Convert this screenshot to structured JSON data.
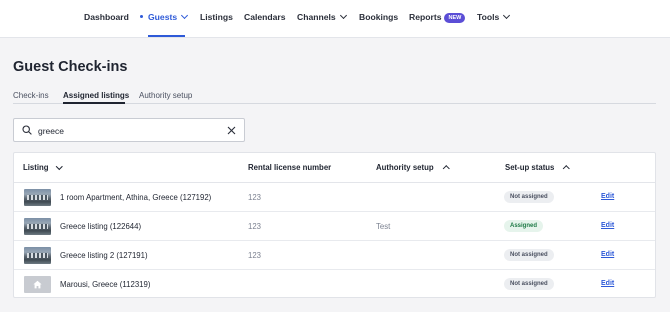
{
  "nav": {
    "items": [
      {
        "label": "Dashboard"
      },
      {
        "label": "Guests"
      },
      {
        "label": "Listings"
      },
      {
        "label": "Calendars"
      },
      {
        "label": "Channels"
      },
      {
        "label": "Bookings"
      },
      {
        "label": "Reports",
        "badge": "NEW"
      },
      {
        "label": "Tools"
      }
    ],
    "accent_color": "#2e5ad8",
    "badge_color": "#5b4ed6"
  },
  "page": {
    "title": "Guest Check-ins"
  },
  "tabs": [
    {
      "label": "Check-ins"
    },
    {
      "label": "Assigned listings"
    },
    {
      "label": "Authority setup"
    }
  ],
  "search": {
    "value": "greece"
  },
  "table": {
    "headers": {
      "listing": "Listing",
      "license": "Rental license number",
      "authority": "Authority setup",
      "status": "Set-up status"
    },
    "rows": [
      {
        "name": "1 room Apartment, Athina, Greece (127192)",
        "license": "123",
        "authority": "",
        "status": "Not assigned",
        "action": "Edit",
        "thumb": "photo"
      },
      {
        "name": "Greece listing (122644)",
        "license": "123",
        "authority": "Test",
        "status": "Assigned",
        "action": "Edit",
        "thumb": "photo"
      },
      {
        "name": "Greece listing 2 (127191)",
        "license": "123",
        "authority": "",
        "status": "Not assigned",
        "action": "Edit",
        "thumb": "photo"
      },
      {
        "name": "Marousi, Greece (112319)",
        "license": "",
        "authority": "",
        "status": "Not assigned",
        "action": "Edit",
        "thumb": "home-icon"
      }
    ]
  }
}
